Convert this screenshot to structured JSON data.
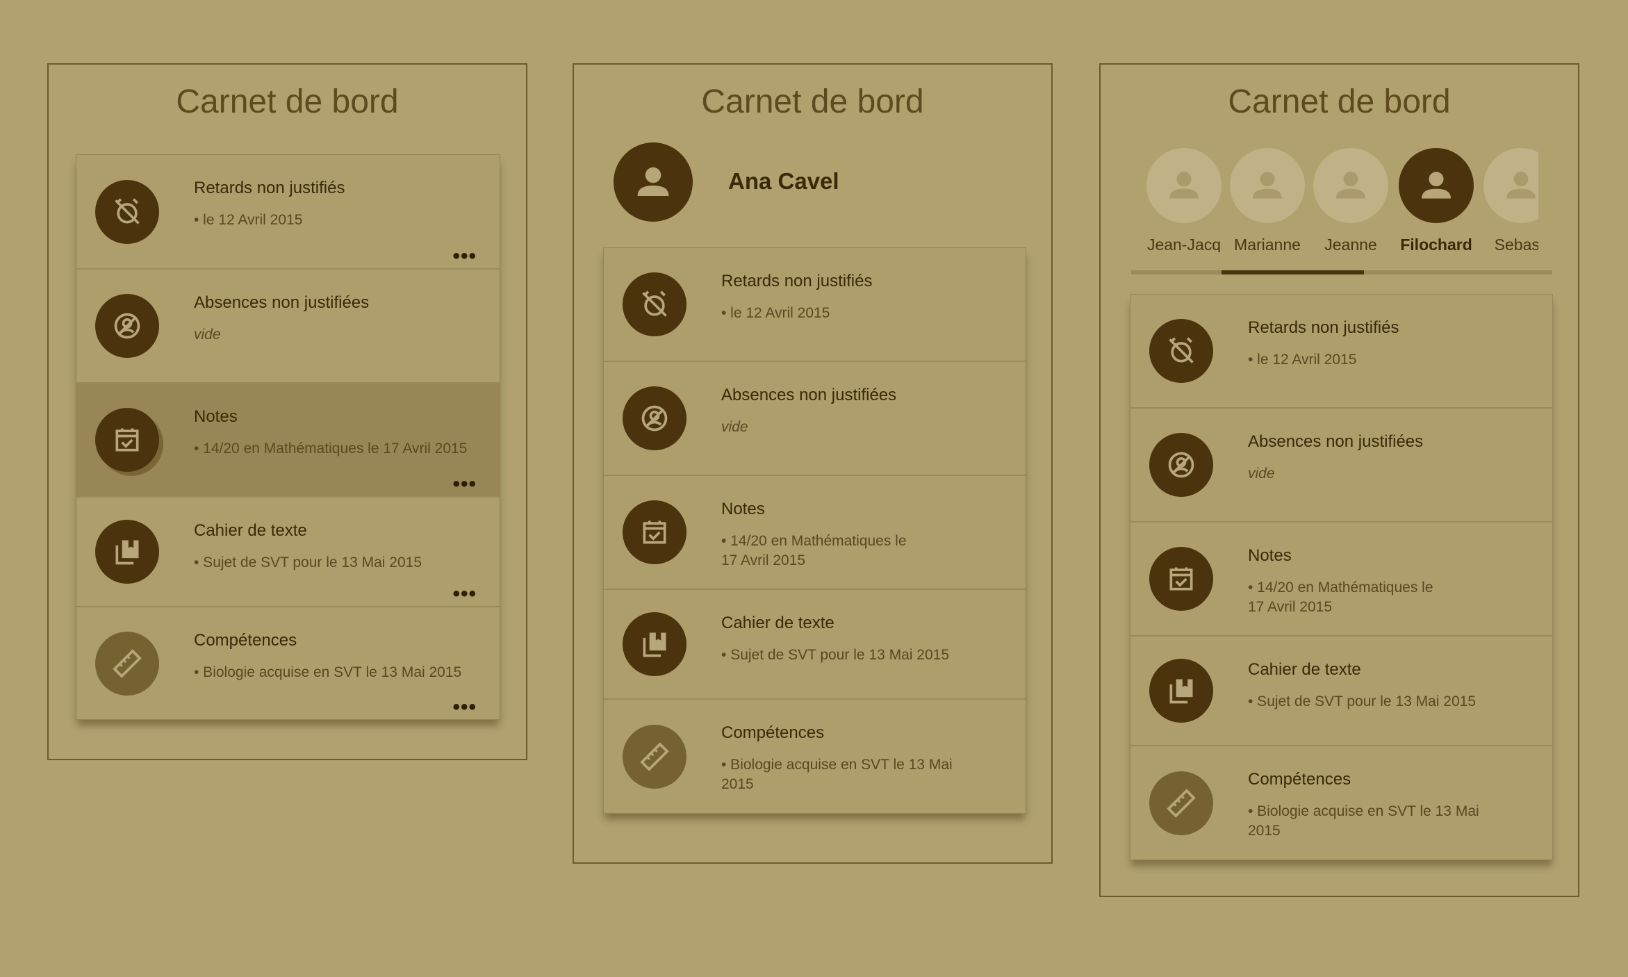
{
  "panels": [
    {
      "title": "Carnet de bord",
      "rows": [
        {
          "title": "Retards non justifiés",
          "sub": "• le 12 Avril 2015",
          "icon": "alarm-off-icon",
          "more": "•••"
        },
        {
          "title": "Absences non justifiées",
          "sub": "vide",
          "icon": "person-off-icon",
          "more": ""
        },
        {
          "title": "Notes",
          "sub": "• 14/20 en Mathématiques le 17 Avril 2015",
          "icon": "event-available-icon",
          "more": "•••"
        },
        {
          "title": "Cahier de texte",
          "sub": "• Sujet de SVT pour le 13 Mai 2015",
          "icon": "library-books-icon",
          "more": "•••"
        },
        {
          "title": "Compétences",
          "sub": "• Biologie acquise en SVT le 13 Mai 2015",
          "icon": "ruler-icon",
          "more": "•••"
        }
      ]
    },
    {
      "title": "Carnet de bord",
      "student_name": "Ana Cavel",
      "rows": [
        {
          "title": "Retards non justifiés",
          "sub": "• le 12 Avril 2015",
          "icon": "alarm-off-icon"
        },
        {
          "title": "Absences non justifiées",
          "sub": "vide",
          "icon": "person-off-icon"
        },
        {
          "title": "Notes",
          "sub": "• 14/20 en Mathématiques le\n17 Avril 2015",
          "icon": "event-available-icon"
        },
        {
          "title": "Cahier de texte",
          "sub": "• Sujet de SVT pour le 13 Mai 2015",
          "icon": "library-books-icon"
        },
        {
          "title": "Compétences",
          "sub": "• Biologie acquise en SVT le 13 Mai\n2015",
          "icon": "ruler-icon"
        }
      ]
    },
    {
      "title": "Carnet de bord",
      "students": [
        "Jean-Jacq",
        "Marianne",
        "Jeanne",
        "Filochard",
        "Sebasti"
      ],
      "selected_student": "Filochard",
      "rows": [
        {
          "title": "Retards non justifiés",
          "sub": "• le 12 Avril 2015",
          "icon": "alarm-off-icon"
        },
        {
          "title": "Absences non justifiées",
          "sub": "vide",
          "icon": "person-off-icon"
        },
        {
          "title": "Notes",
          "sub": "• 14/20 en Mathématiques le\n17 Avril 2015",
          "icon": "event-available-icon"
        },
        {
          "title": "Cahier de texte",
          "sub": "• Sujet de SVT pour le 13 Mai 2015",
          "icon": "library-books-icon"
        },
        {
          "title": "Compétences",
          "sub": "• Biologie acquise en SVT le 13 Mai\n2015",
          "icon": "ruler-icon"
        }
      ]
    }
  ],
  "colors": {
    "background": "#b0a16f",
    "accent": "#4a330d",
    "card": "#ad9e6c"
  }
}
